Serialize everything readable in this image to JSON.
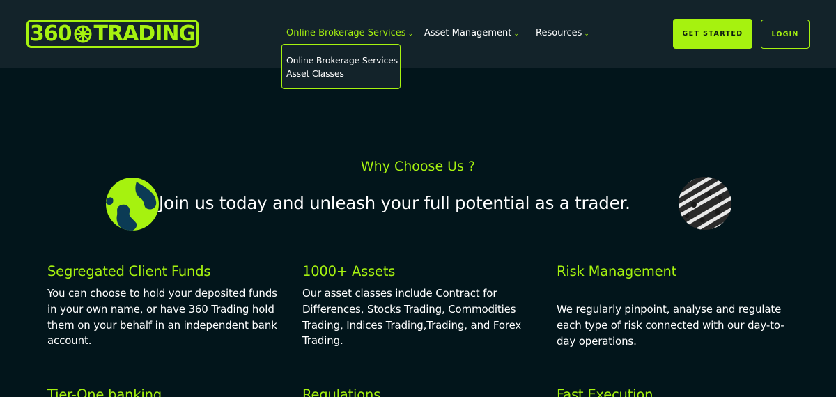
{
  "logo": {
    "text_left": "360",
    "text_right": "TRADING"
  },
  "nav": {
    "items": [
      {
        "label": "Online Brokerage Services",
        "active": true
      },
      {
        "label": "Asset Management",
        "active": false
      },
      {
        "label": "Resources",
        "active": false
      }
    ],
    "dropdown": [
      "Online Brokerage Services",
      "Asset Classes"
    ],
    "chevron_icon": "chevron-down-icon"
  },
  "header": {
    "get_started_label": "GET STARTED",
    "login_label": "LOGIN"
  },
  "hero": {
    "eyebrow": "Why Choose Us ?",
    "tagline": "Join us today and unleash your full potential as a trader."
  },
  "features": [
    {
      "title": "Segregated Client Funds",
      "body": "You can choose to hold your deposited funds in your own name, or have 360 Trading hold them on your behalf in an independent bank account."
    },
    {
      "title": "1000+ Assets",
      "body": "Our asset classes include Contract for Differences, Stocks Trading, Commodities Trading, Indices Trading,Trading, and Forex Trading."
    },
    {
      "title": "Risk Management",
      "body": "We regularly pinpoint, analyse and regulate each type of risk connected with our day-to-day operations."
    },
    {
      "title": "Tier-One banking",
      "body": ""
    },
    {
      "title": "Regulations",
      "body": ""
    },
    {
      "title": "Fast Execution",
      "body": ""
    }
  ],
  "colors": {
    "accent": "#a6f20f",
    "background": "#02151b",
    "header_bg": "#13232a"
  }
}
